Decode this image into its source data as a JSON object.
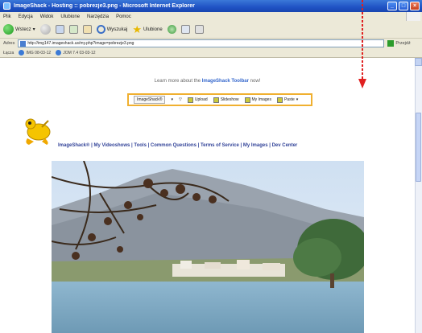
{
  "window": {
    "title": "ImageShack - Hosting :: pobrezje3.png - Microsoft Internet Explorer",
    "buttons": {
      "minimize": "_",
      "maximize": "□",
      "close": "×"
    }
  },
  "menu": [
    "Plik",
    "Edycja",
    "Widok",
    "Ulubione",
    "Narzędzia",
    "Pomoc"
  ],
  "toolbar": {
    "back_label": "Wstecz",
    "search_label": "Wyszukaj",
    "favorites_label": "Ulubione"
  },
  "addressbar": {
    "label": "Adres",
    "url": "http://img147.imageshack.us/my.php?image=pobrezje3.png",
    "go_label": "Przejdź"
  },
  "linksbar": {
    "label": "Łącza",
    "items": [
      "IMG 08-03-12",
      "JOM 7.4 03-03-12"
    ]
  },
  "page": {
    "learn_text": "Learn more about the",
    "learn_link": "ImageShack Toolbar",
    "learn_suffix": "now!",
    "toolbar_dropdown": "ImageShack®",
    "toolbar_items": [
      "Upload",
      "Slideshow",
      "My Images",
      "Paste"
    ],
    "nav_links": "ImageShack® | My Videoshows | Tools | Common Questions | Terms of Service | My Images | Dev Center"
  },
  "colors": {
    "titlebar": "#1f52c4",
    "chrome": "#ece9d8",
    "toolbar_border": "#f0b030",
    "arrow": "#e02020"
  },
  "icons": [
    "app-icon",
    "back-arrow-icon",
    "forward-arrow-icon",
    "stop-icon",
    "refresh-icon",
    "home-icon",
    "search-icon",
    "favorites-star-icon",
    "history-icon",
    "mail-icon",
    "print-icon",
    "frog-logo-icon",
    "red-arrow-icon"
  ]
}
